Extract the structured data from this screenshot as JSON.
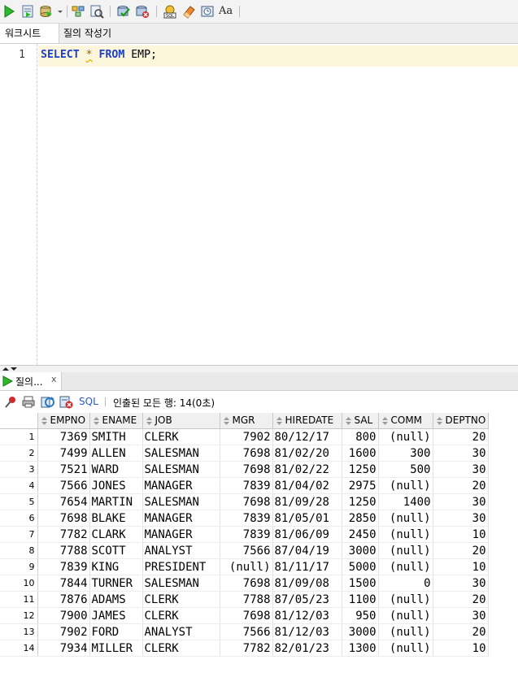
{
  "toolbar": {
    "buttons": [
      {
        "name": "run-statement-button",
        "icon": "green-play-icon"
      },
      {
        "name": "run-script-button",
        "icon": "script-icon"
      },
      {
        "name": "commit-dropdown-button",
        "icon": "db-commit-icon"
      },
      {
        "name": "explain-plan-button",
        "icon": "explain-icon"
      },
      {
        "name": "autotrace-button",
        "icon": "trace-icon"
      },
      {
        "name": "commit-button",
        "icon": "commit-icon"
      },
      {
        "name": "rollback-button",
        "icon": "rollback-icon"
      },
      {
        "name": "sql-tuning-button",
        "icon": "sql-tuning-icon"
      },
      {
        "name": "clear-button",
        "icon": "eraser-icon"
      },
      {
        "name": "history-button",
        "icon": "history-icon"
      },
      {
        "name": "format-button",
        "icon": "format-aa-icon"
      }
    ],
    "format_label": "Aa"
  },
  "tabs": {
    "worksheet": "워크시트",
    "query_builder": "질의 작성기"
  },
  "editor": {
    "line_number": "1",
    "tokens": {
      "select": "SELECT",
      "star": "*",
      "from": "FROM",
      "table": "EMP;"
    }
  },
  "results": {
    "tab_label": "질의...",
    "tab_close": "x",
    "sql_label": "SQL",
    "status": "인출된 모든 행: 14(0초)",
    "columns": [
      "EMPNO",
      "ENAME",
      "JOB",
      "MGR",
      "HIREDATE",
      "SAL",
      "COMM",
      "DEPTNO"
    ],
    "rows": [
      [
        "7369",
        "SMITH",
        "CLERK",
        "7902",
        "80/12/17",
        "800",
        "(null)",
        "20"
      ],
      [
        "7499",
        "ALLEN",
        "SALESMAN",
        "7698",
        "81/02/20",
        "1600",
        "300",
        "30"
      ],
      [
        "7521",
        "WARD",
        "SALESMAN",
        "7698",
        "81/02/22",
        "1250",
        "500",
        "30"
      ],
      [
        "7566",
        "JONES",
        "MANAGER",
        "7839",
        "81/04/02",
        "2975",
        "(null)",
        "20"
      ],
      [
        "7654",
        "MARTIN",
        "SALESMAN",
        "7698",
        "81/09/28",
        "1250",
        "1400",
        "30"
      ],
      [
        "7698",
        "BLAKE",
        "MANAGER",
        "7839",
        "81/05/01",
        "2850",
        "(null)",
        "30"
      ],
      [
        "7782",
        "CLARK",
        "MANAGER",
        "7839",
        "81/06/09",
        "2450",
        "(null)",
        "10"
      ],
      [
        "7788",
        "SCOTT",
        "ANALYST",
        "7566",
        "87/04/19",
        "3000",
        "(null)",
        "20"
      ],
      [
        "7839",
        "KING",
        "PRESIDENT",
        "(null)",
        "81/11/17",
        "5000",
        "(null)",
        "10"
      ],
      [
        "7844",
        "TURNER",
        "SALESMAN",
        "7698",
        "81/09/08",
        "1500",
        "0",
        "30"
      ],
      [
        "7876",
        "ADAMS",
        "CLERK",
        "7788",
        "87/05/23",
        "1100",
        "(null)",
        "20"
      ],
      [
        "7900",
        "JAMES",
        "CLERK",
        "7698",
        "81/12/03",
        "950",
        "(null)",
        "30"
      ],
      [
        "7902",
        "FORD",
        "ANALYST",
        "7566",
        "81/12/03",
        "3000",
        "(null)",
        "20"
      ],
      [
        "7934",
        "MILLER",
        "CLERK",
        "7782",
        "82/01/23",
        "1300",
        "(null)",
        "10"
      ]
    ]
  },
  "colors": {
    "keyword": "#1e3ec8",
    "current_line": "#fbf6dc",
    "star_warning": "#e4b400"
  }
}
